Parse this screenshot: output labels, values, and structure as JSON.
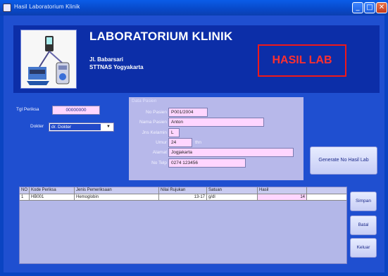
{
  "window": {
    "title": "Hasil Laboratorium Klinik",
    "minimize": "_",
    "maximize": "□",
    "close": "✕"
  },
  "header": {
    "title": "LABORATORIUM KLINIK",
    "address": "Jl. Babarsari",
    "city": "STTNAS Yogyakarta",
    "badge": "HASIL LAB"
  },
  "form": {
    "tanggal_label": "Tgl Periksa",
    "tanggal_value": "00000000",
    "dokter_label": "Dokter",
    "dokter_value": "dr. Dokter"
  },
  "patient": {
    "header": "Data Pasien",
    "fields": [
      {
        "label": "No Pasien",
        "value": "P001/2004"
      },
      {
        "label": "Nama Pasien",
        "value": "Anton"
      },
      {
        "label": "Jns Kelamin",
        "value": "L"
      },
      {
        "label": "Umur",
        "value": "24",
        "suffix": "thn"
      },
      {
        "label": "Alamat",
        "value": "Jogjakarta"
      },
      {
        "label": "No Telp",
        "value": "0274 123456"
      }
    ]
  },
  "buttons": {
    "generate": "Generate No Hasil Lab",
    "simpan": "Simpan",
    "batal": "Batal",
    "keluar": "Keluar"
  },
  "grid": {
    "columns": [
      "NO",
      "Kode Periksa",
      "Jenis Pemeriksaan",
      "Nilai Rujukan",
      "Satuan",
      "Hasil"
    ],
    "rows": [
      [
        "1",
        "HB001",
        "Hemoglobin",
        "13-17",
        "g/dl",
        "14"
      ]
    ]
  },
  "colors": {
    "titlebar": "#0a5de8",
    "client": "#1f4fd0",
    "header": "#0c2ea8",
    "accent_red": "#f01818",
    "field_pink": "#ffd6ff"
  }
}
